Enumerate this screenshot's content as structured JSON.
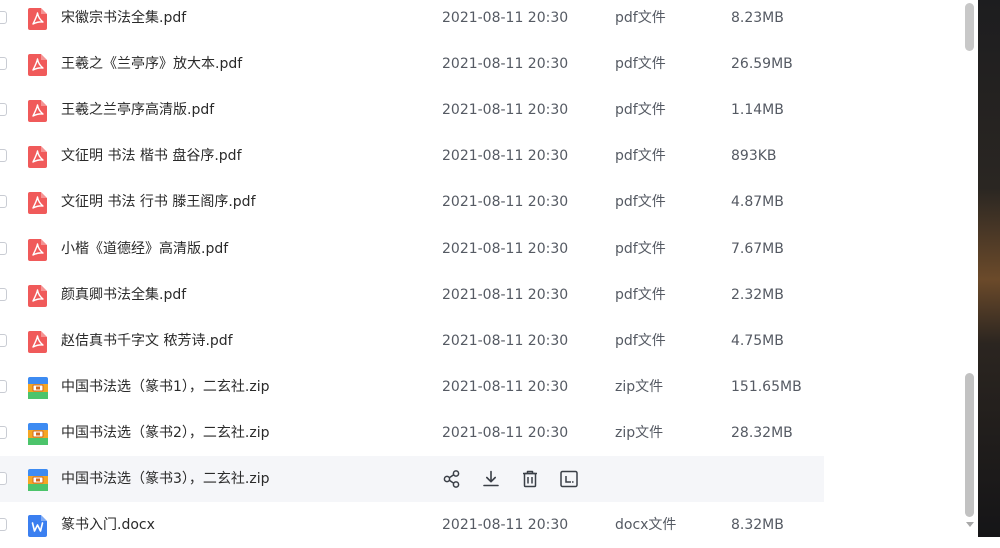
{
  "files": [
    {
      "name": "宋徽宗书法全集.pdf",
      "date": "2021-08-11 20:30",
      "type": "pdf文件",
      "size": "8.23MB",
      "icon": "pdf-icon"
    },
    {
      "name": "王羲之《兰亭序》放大本.pdf",
      "date": "2021-08-11 20:30",
      "type": "pdf文件",
      "size": "26.59MB",
      "icon": "pdf-icon"
    },
    {
      "name": "王羲之兰亭序高清版.pdf",
      "date": "2021-08-11 20:30",
      "type": "pdf文件",
      "size": "1.14MB",
      "icon": "pdf-icon"
    },
    {
      "name": "文征明 书法 楷书 盘谷序.pdf",
      "date": "2021-08-11 20:30",
      "type": "pdf文件",
      "size": "893KB",
      "icon": "pdf-icon"
    },
    {
      "name": "文征明 书法 行书 滕王阁序.pdf",
      "date": "2021-08-11 20:30",
      "type": "pdf文件",
      "size": "4.87MB",
      "icon": "pdf-icon"
    },
    {
      "name": "小楷《道德经》高清版.pdf",
      "date": "2021-08-11 20:30",
      "type": "pdf文件",
      "size": "7.67MB",
      "icon": "pdf-icon"
    },
    {
      "name": "颜真卿书法全集.pdf",
      "date": "2021-08-11 20:30",
      "type": "pdf文件",
      "size": "2.32MB",
      "icon": "pdf-icon"
    },
    {
      "name": "赵佶真书千字文 秾芳诗.pdf",
      "date": "2021-08-11 20:30",
      "type": "pdf文件",
      "size": "4.75MB",
      "icon": "pdf-icon"
    },
    {
      "name": "中国书法选（篆书1），二玄社.zip",
      "date": "2021-08-11 20:30",
      "type": "zip文件",
      "size": "151.65MB",
      "icon": "zip-icon"
    },
    {
      "name": "中国书法选（篆书2），二玄社.zip",
      "date": "2021-08-11 20:30",
      "type": "zip文件",
      "size": "28.32MB",
      "icon": "zip-icon"
    },
    {
      "name": "中国书法选（篆书3），二玄社.zip",
      "date": "",
      "type": "",
      "size": "",
      "icon": "zip-icon",
      "hover": true
    },
    {
      "name": "篆书入门.docx",
      "date": "2021-08-11 20:30",
      "type": "docx文件",
      "size": "8.32MB",
      "icon": "word-icon"
    }
  ],
  "hover_actions": [
    "share-icon",
    "download-icon",
    "delete-icon",
    "more-icon"
  ],
  "colors": {
    "pdf": "#f05a5a",
    "zip_blue": "#3d8bf2",
    "zip_orange": "#f5a623",
    "zip_green": "#4cc46b",
    "word": "#3b7ff0",
    "hover_row": "#f5f6f9"
  }
}
